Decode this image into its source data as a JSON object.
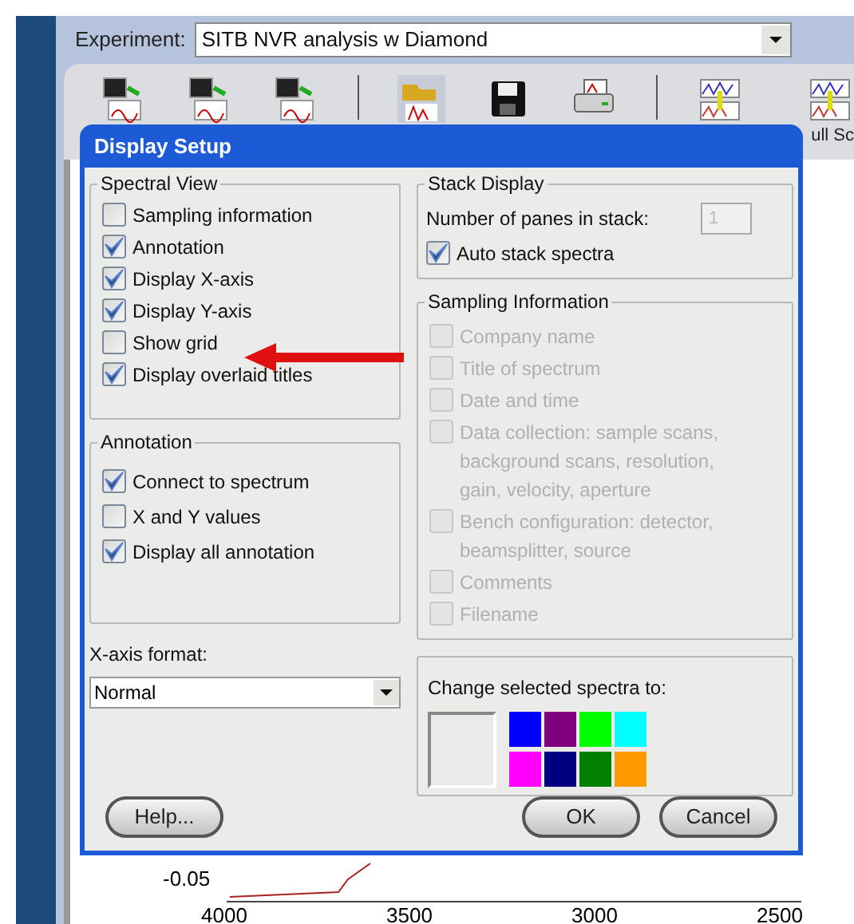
{
  "experiment": {
    "label": "Experiment:",
    "value": "SITB NVR analysis w Diamond"
  },
  "toolbar": {
    "cut_label": "ull Sc"
  },
  "chart_behind": {
    "y_label": "-0.05",
    "x_labels": [
      "4000",
      "3500",
      "3000",
      "2500"
    ]
  },
  "dialog": {
    "title": "Display Setup",
    "spectral_view": {
      "title": "Spectral View",
      "items": [
        {
          "label": "Sampling information",
          "checked": false
        },
        {
          "label": "Annotation",
          "checked": true
        },
        {
          "label": "Display X-axis",
          "checked": true
        },
        {
          "label": "Display Y-axis",
          "checked": true
        },
        {
          "label": "Show grid",
          "checked": false,
          "pointed_by_arrow": true
        },
        {
          "label": "Display overlaid titles",
          "checked": true
        }
      ]
    },
    "annotation": {
      "title": "Annotation",
      "items": [
        {
          "label": "Connect to spectrum",
          "checked": true
        },
        {
          "label": "X and Y values",
          "checked": false
        },
        {
          "label": "Display all annotation",
          "checked": true
        }
      ]
    },
    "x_axis_format": {
      "label": "X-axis format:",
      "value": "Normal"
    },
    "stack_display": {
      "title": "Stack Display",
      "panes_label": "Number of panes in stack:",
      "panes_value": "1",
      "auto_stack": {
        "label": "Auto stack spectra",
        "checked": true
      }
    },
    "sampling_information": {
      "title": "Sampling Information",
      "disabled": true,
      "items": [
        {
          "label": "Company name",
          "checked": false
        },
        {
          "label": "Title of spectrum",
          "checked": false
        },
        {
          "label": "Date and time",
          "checked": false
        },
        {
          "label": "Data collection: sample scans,\nbackground scans, resolution,\ngain, velocity, aperture",
          "checked": false
        },
        {
          "label": "Bench configuration: detector,\nbeamsplitter, source",
          "checked": false
        },
        {
          "label": "Comments",
          "checked": false
        },
        {
          "label": "Filename",
          "checked": false
        }
      ]
    },
    "color_change": {
      "label": "Change selected spectra to:",
      "colors": [
        {
          "color": "#0000ff"
        },
        {
          "color": "#800080"
        },
        {
          "color": "#00ff00"
        },
        {
          "color": "#00ffff"
        },
        {
          "color": "#ff00ff"
        },
        {
          "color": "#000080"
        },
        {
          "color": "#008000"
        },
        {
          "color": "#ff9900"
        }
      ]
    },
    "buttons": [
      {
        "label": "Help...",
        "kind": "left"
      },
      {
        "label": "OK",
        "kind": "right"
      },
      {
        "label": "Cancel",
        "kind": "right"
      }
    ]
  }
}
